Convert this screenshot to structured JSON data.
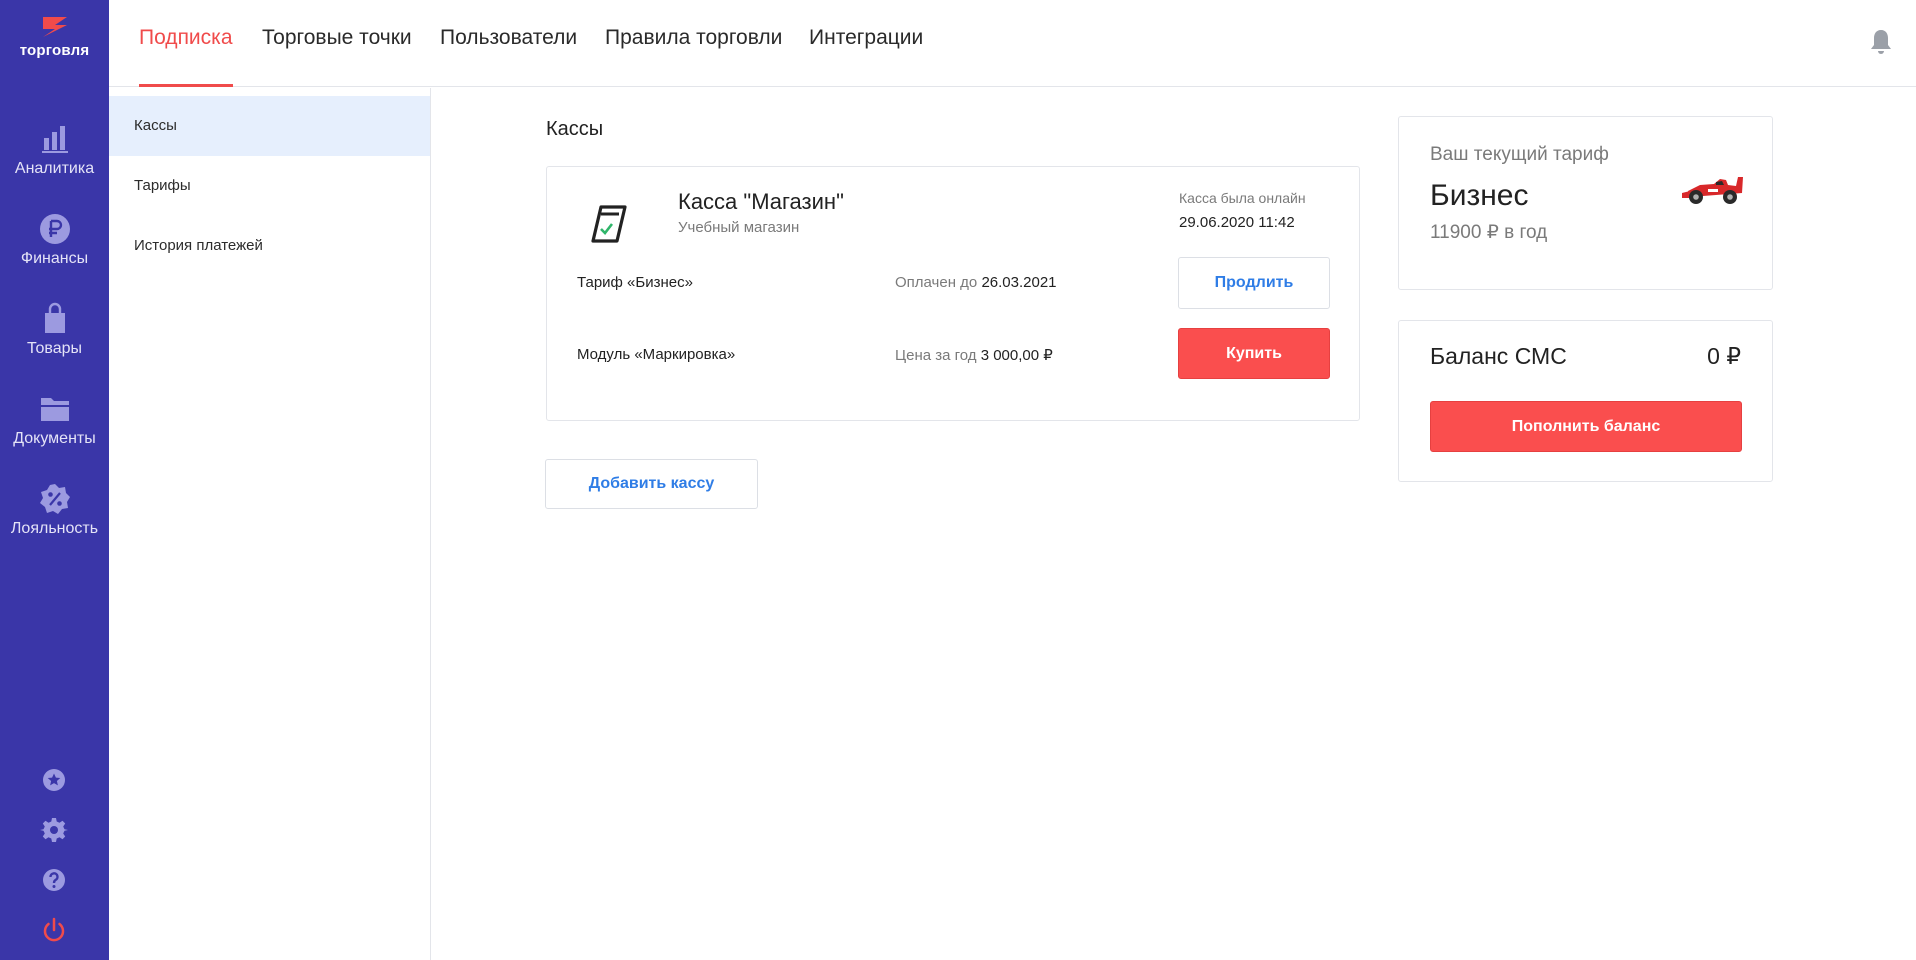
{
  "brand": {
    "name": "торговля",
    "accent": "#f04b4b",
    "sidebar_bg": "#3a36a8"
  },
  "sidebar": {
    "items": [
      {
        "label": "Аналитика",
        "icon": "bar-chart-icon"
      },
      {
        "label": "Финансы",
        "icon": "ruble-icon"
      },
      {
        "label": "Товары",
        "icon": "shopping-bag-icon"
      },
      {
        "label": "Документы",
        "icon": "folder-icon"
      },
      {
        "label": "Лояльность",
        "icon": "percent-badge-icon"
      }
    ],
    "bottom_icons": [
      "star-icon",
      "gear-icon",
      "help-icon",
      "power-icon"
    ]
  },
  "topnav": {
    "tabs": [
      {
        "label": "Подписка",
        "active": true
      },
      {
        "label": "Торговые точки",
        "active": false
      },
      {
        "label": "Пользователи",
        "active": false
      },
      {
        "label": "Правила торговли",
        "active": false
      },
      {
        "label": "Интеграции",
        "active": false
      }
    ],
    "bell_icon": "bell-icon"
  },
  "subnav": {
    "items": [
      {
        "label": "Кассы",
        "active": true
      },
      {
        "label": "Тарифы",
        "active": false
      },
      {
        "label": "История платежей",
        "active": false
      }
    ]
  },
  "main": {
    "title": "Кассы",
    "kassa": {
      "name": "Касса \"Магазин\"",
      "subtitle": "Учебный магазин",
      "online_label": "Касса была онлайн",
      "online_date": "29.06.2020 11:42",
      "rows": [
        {
          "label": "Тариф «Бизнес»",
          "mid_label": "Оплачен до",
          "mid_value": "26.03.2021",
          "button": "Продлить"
        },
        {
          "label": "Модуль «Маркировка»",
          "mid_label": "Цена за год",
          "mid_value": "3 000,00 ₽",
          "button": "Купить"
        }
      ]
    },
    "add_button": "Добавить кассу"
  },
  "right": {
    "tariff": {
      "label": "Ваш текущий тариф",
      "name": "Бизнес",
      "price": "11900 ₽ в год"
    },
    "sms": {
      "label": "Баланс СМС",
      "value": "0 ₽",
      "button": "Пополнить баланс"
    }
  }
}
